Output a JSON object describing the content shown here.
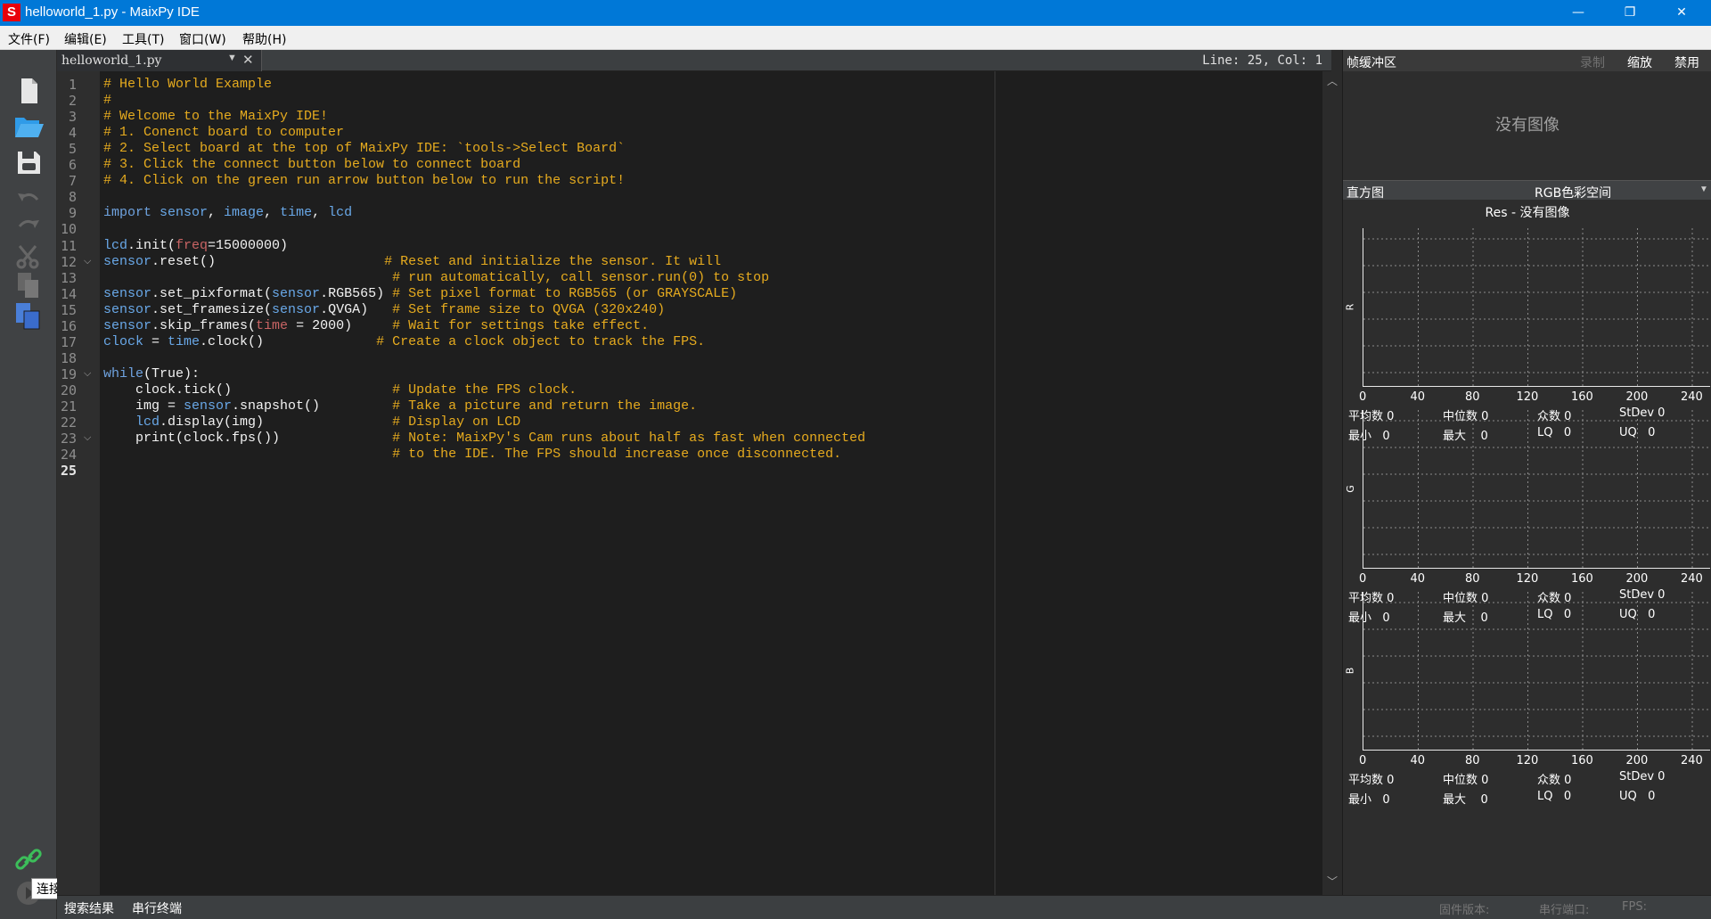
{
  "window": {
    "title": "helloworld_1.py - MaixPy IDE",
    "app_icon_letter": "S",
    "minimize": "—",
    "maximize": "❐",
    "close": "✕"
  },
  "menu": [
    "文件(F)",
    "编辑(E)",
    "工具(T)",
    "窗口(W)",
    "帮助(H)"
  ],
  "sidebar": {
    "tooltip": "连接"
  },
  "tab": {
    "name": "helloworld_1.py"
  },
  "cursor": {
    "position": "Line: 25, Col: 1"
  },
  "editor": {
    "current_line": 25,
    "fold_lines": [
      12,
      19,
      23
    ],
    "lines": [
      [
        [
          "cm",
          "# Hello World Example"
        ]
      ],
      [
        [
          "cm",
          "#"
        ]
      ],
      [
        [
          "cm",
          "# Welcome to the MaixPy IDE!"
        ]
      ],
      [
        [
          "cm",
          "# 1. Conenct board to computer"
        ]
      ],
      [
        [
          "cm",
          "# 2. Select board at the top of MaixPy IDE: `tools->Select Board`"
        ]
      ],
      [
        [
          "cm",
          "# 3. Click the connect button below to connect board"
        ]
      ],
      [
        [
          "cm",
          "# 4. Click on the green run arrow button below to run the script!"
        ]
      ],
      [],
      [
        [
          "kw",
          "import"
        ],
        [
          "md",
          " sensor"
        ],
        [
          "nm",
          ", "
        ],
        [
          "md",
          "image"
        ],
        [
          "nm",
          ", "
        ],
        [
          "md",
          "time"
        ],
        [
          "nm",
          ", "
        ],
        [
          "md",
          "lcd"
        ]
      ],
      [],
      [
        [
          "md",
          "lcd"
        ],
        [
          "nm",
          ".init("
        ],
        [
          "arg",
          "freq"
        ],
        [
          "nm",
          "=15000000)"
        ]
      ],
      [
        [
          "md",
          "sensor"
        ],
        [
          "nm",
          ".reset()"
        ],
        [
          "nm",
          "                     "
        ],
        [
          "cm",
          "# Reset and initialize the sensor. It will"
        ]
      ],
      [
        [
          "nm",
          "                                    "
        ],
        [
          "cm",
          "# run automatically, call sensor.run(0) to stop"
        ]
      ],
      [
        [
          "md",
          "sensor"
        ],
        [
          "nm",
          ".set_pixformat("
        ],
        [
          "md",
          "sensor"
        ],
        [
          "nm",
          ".RGB565) "
        ],
        [
          "cm",
          "# Set pixel format to RGB565 (or GRAYSCALE)"
        ]
      ],
      [
        [
          "md",
          "sensor"
        ],
        [
          "nm",
          ".set_framesize("
        ],
        [
          "md",
          "sensor"
        ],
        [
          "nm",
          ".QVGA)   "
        ],
        [
          "cm",
          "# Set frame size to QVGA (320x240)"
        ]
      ],
      [
        [
          "md",
          "sensor"
        ],
        [
          "nm",
          ".skip_frames("
        ],
        [
          "arg",
          "time"
        ],
        [
          "nm",
          " = 2000)     "
        ],
        [
          "cm",
          "# Wait for settings take effect."
        ]
      ],
      [
        [
          "md",
          "clock"
        ],
        [
          "nm",
          " = "
        ],
        [
          "md",
          "time"
        ],
        [
          "nm",
          ".clock()"
        ],
        [
          "nm",
          "              "
        ],
        [
          "cm",
          "# Create a clock object to track the FPS."
        ]
      ],
      [],
      [
        [
          "kw",
          "while"
        ],
        [
          "nm",
          "(True):"
        ]
      ],
      [
        [
          "nm",
          "    clock.tick()                    "
        ],
        [
          "cm",
          "# Update the FPS clock."
        ]
      ],
      [
        [
          "nm",
          "    img = "
        ],
        [
          "md",
          "sensor"
        ],
        [
          "nm",
          ".snapshot()         "
        ],
        [
          "cm",
          "# Take a picture and return the image."
        ]
      ],
      [
        [
          "nm",
          "    "
        ],
        [
          "md",
          "lcd"
        ],
        [
          "nm",
          ".display(img)                "
        ],
        [
          "cm",
          "# Display on LCD"
        ]
      ],
      [
        [
          "nm",
          "    print(clock.fps())              "
        ],
        [
          "cm",
          "# Note: MaixPy's Cam runs about half as fast when connected"
        ]
      ],
      [
        [
          "nm",
          "                                    "
        ],
        [
          "cm",
          "# to the IDE. The FPS should increase once disconnected."
        ]
      ],
      []
    ]
  },
  "status": {
    "search_results": "搜索结果",
    "serial_terminal": "串行终端",
    "firmware": "固件版本:",
    "serial_port": "串行端口:",
    "fps": "FPS:"
  },
  "frame_buffer": {
    "title": "帧缓冲区",
    "record": "录制",
    "zoom": "缩放",
    "disable": "禁用",
    "no_image": "没有图像"
  },
  "histogram": {
    "title": "直方图",
    "colorspace": "RGB色彩空间",
    "res_title": "Res - 没有图像",
    "x_ticks": [
      "0",
      "40",
      "80",
      "120",
      "160",
      "200",
      "240"
    ],
    "channels": [
      {
        "label": "R",
        "mean": "平均数 0",
        "median": "中位数 0",
        "mode": "众数 0",
        "stdev": "StDev 0",
        "min": "最小   0",
        "max": "最大    0",
        "lq": "LQ   0",
        "uq": "UQ   0"
      },
      {
        "label": "G",
        "mean": "平均数 0",
        "median": "中位数 0",
        "mode": "众数 0",
        "stdev": "StDev 0",
        "min": "最小   0",
        "max": "最大    0",
        "lq": "LQ   0",
        "uq": "UQ   0"
      },
      {
        "label": "B",
        "mean": "平均数 0",
        "median": "中位数 0",
        "mode": "众数 0",
        "stdev": "StDev 0",
        "min": "最小   0",
        "max": "最大    0",
        "lq": "LQ   0",
        "uq": "UQ   0"
      }
    ]
  },
  "colors": {
    "titlebar": "#0078d7",
    "comment": "#e6ab1e",
    "module": "#69a8e8",
    "argument": "#c86464",
    "connect_icon": "#3cbe5a",
    "open_icon": "#2f9be8",
    "paste_icon": "#4a7fd8"
  }
}
